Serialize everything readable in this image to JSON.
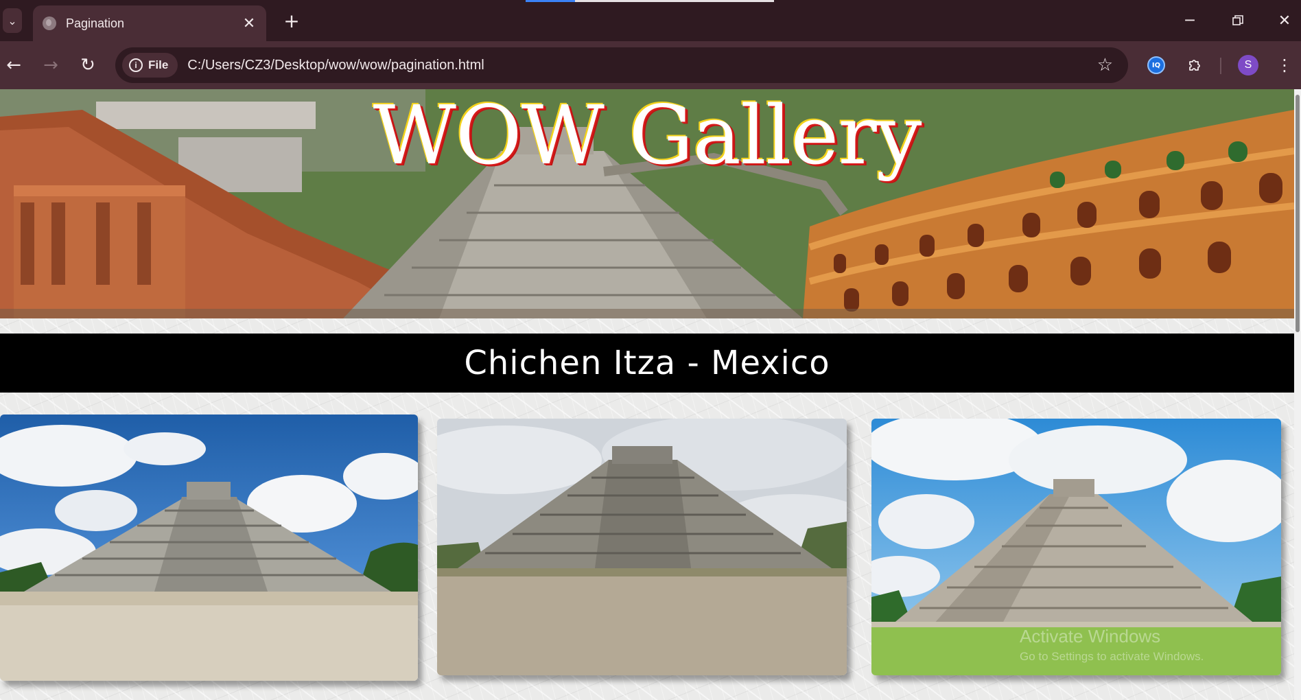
{
  "browser": {
    "tab_title": "Pagination",
    "tab_close_glyph": "✕",
    "new_tab_glyph": "+",
    "url_scheme_label": "File",
    "url": "C:/Users/CZ3/Desktop/wow/wow/pagination.html",
    "profile_initial": "S",
    "extension_badge": "IQ",
    "icons": [
      "tab-list-icon",
      "globe-icon",
      "close-icon",
      "plus-icon",
      "minimize-icon",
      "restore-icon",
      "close-window-icon",
      "back-arrow-icon",
      "forward-arrow-icon",
      "reload-icon",
      "info-icon",
      "star-icon",
      "extension-icon",
      "puzzle-icon",
      "more-vert-icon"
    ],
    "accent_color": "#3b82f6",
    "frame_color": "#2f1a21"
  },
  "page": {
    "banner_title": "WOW Gallery",
    "heading": "Chichen Itza - Mexico",
    "photos": [
      "chichen-itza-photo-1",
      "chichen-itza-photo-2",
      "chichen-itza-photo-3"
    ],
    "title_colors": {
      "fill": "#ffffff",
      "outline_red": "#d81b1b",
      "outline_yellow": "#f3d21a"
    }
  },
  "watermark": {
    "line1": "Activate Windows",
    "line2": "Go to Settings to activate Windows."
  }
}
